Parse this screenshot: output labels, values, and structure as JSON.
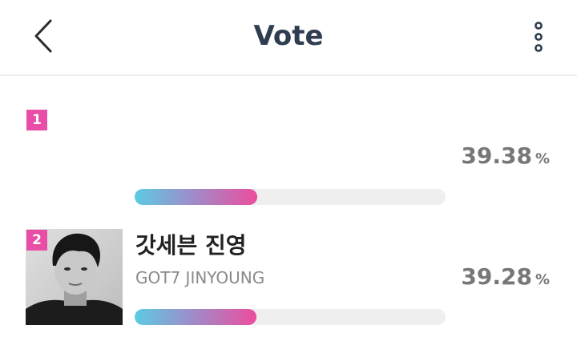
{
  "header": {
    "title": "Vote"
  },
  "items": [
    {
      "rank": "1",
      "name": "",
      "group": "",
      "percent": "39.38",
      "unit": "%",
      "bar_fill": 0.3938
    },
    {
      "rank": "2",
      "name": "갓세븐 진영",
      "group": "GOT7 JINYOUNG",
      "percent": "39.28",
      "unit": "%",
      "bar_fill": 0.3928
    }
  ],
  "colors": {
    "accent": "#e84ea6",
    "title": "#2e3d4f",
    "bar_start": "#5ccbe3",
    "bar_end": "#ec4d9e",
    "track": "#efefef"
  },
  "icons": {
    "back": "chevron-left-icon",
    "more": "more-vertical-icon"
  }
}
